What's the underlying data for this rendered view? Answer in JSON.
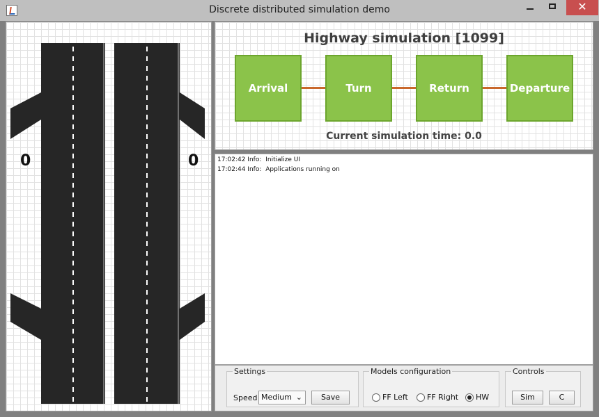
{
  "window": {
    "title": "Discrete distributed simulation demo",
    "close_label": "✕"
  },
  "road": {
    "left_counter": "0",
    "right_counter": "0"
  },
  "simulation": {
    "title": "Highway simulation [1099]",
    "nodes": [
      "Arrival",
      "Turn",
      "Return",
      "Departure"
    ],
    "current_time_label": "Current simulation time: 0.0"
  },
  "log": {
    "lines": [
      {
        "time": "17:02:42",
        "level": "Info:",
        "message": "Initialize UI"
      },
      {
        "time": "17:02:44",
        "level": "Info:",
        "message": "Applications running on"
      }
    ]
  },
  "settings": {
    "label": "Settings",
    "speed_label": "Speed",
    "speed_value": "Medium",
    "save_label": "Save"
  },
  "models": {
    "label": "Models configuration",
    "options": [
      {
        "label": "FF Left",
        "checked": false
      },
      {
        "label": "FF Right",
        "checked": false
      },
      {
        "label": "HW",
        "checked": true
      }
    ]
  },
  "controls": {
    "label": "Controls",
    "sim_label": "Sim",
    "c_label": "C"
  },
  "icons": {
    "app": "java-app-icon",
    "minimize": "minimize-icon",
    "maximize": "maximize-icon",
    "close": "close-icon",
    "dropdown": "chevron-down-icon"
  },
  "colors": {
    "node_fill": "#8bc34a",
    "node_border": "#6ca52d",
    "edge": "#c9682c",
    "close_button": "#c84f4f",
    "road": "#262626"
  }
}
